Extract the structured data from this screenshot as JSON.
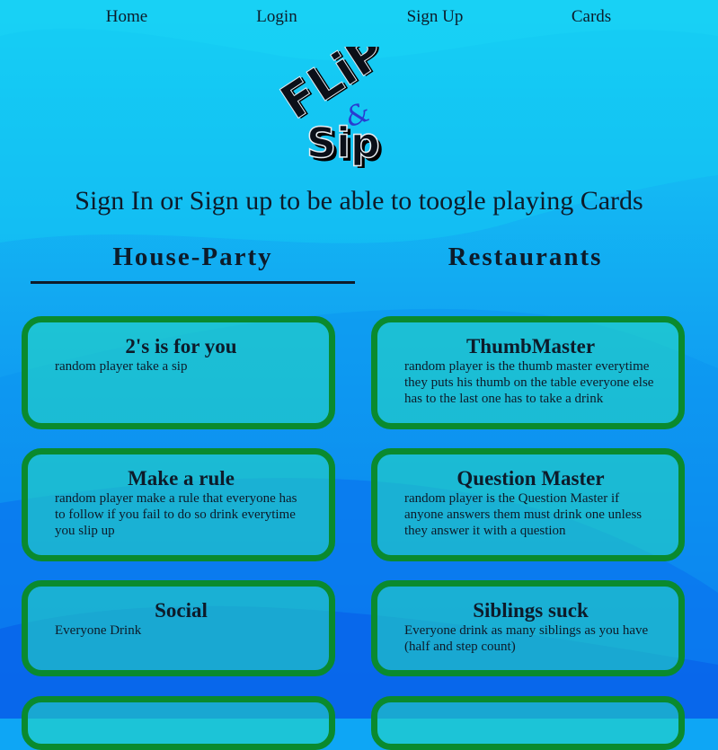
{
  "nav": {
    "items": [
      {
        "label": "Home"
      },
      {
        "label": "Login"
      },
      {
        "label": "Sign Up"
      },
      {
        "label": "Cards"
      }
    ]
  },
  "logo": {
    "line1": "FLiP",
    "amp": "&",
    "line2": "Sip"
  },
  "headline": "Sign In or Sign up to be able to toogle playing Cards",
  "tabs": [
    {
      "label": "House-Party",
      "active": true
    },
    {
      "label": "Restaurants",
      "active": false
    }
  ],
  "cards": {
    "left": [
      {
        "title": "2's is for you",
        "text": "random player take a sip"
      },
      {
        "title": "Make a rule",
        "text": "random player make a rule that everyone has to follow if you fail to do so drink everytime you slip up"
      },
      {
        "title": "Social",
        "text": "Everyone Drink"
      }
    ],
    "right": [
      {
        "title": "ThumbMaster",
        "text": "random player is the thumb master everytime they puts his thumb on the table everyone else has to the last one has to take a drink"
      },
      {
        "title": "Question Master",
        "text": "random player is the Question Master if anyone answers them must drink one unless they answer it with a question"
      },
      {
        "title": "Siblings suck",
        "text": "Everyone drink as many siblings as you have (half and step count)"
      }
    ]
  },
  "colors": {
    "card_border": "#0a8a2e",
    "background_top": "#1ad0f5",
    "background_bottom": "#0a6cf0",
    "text": "#0d1b2a"
  }
}
